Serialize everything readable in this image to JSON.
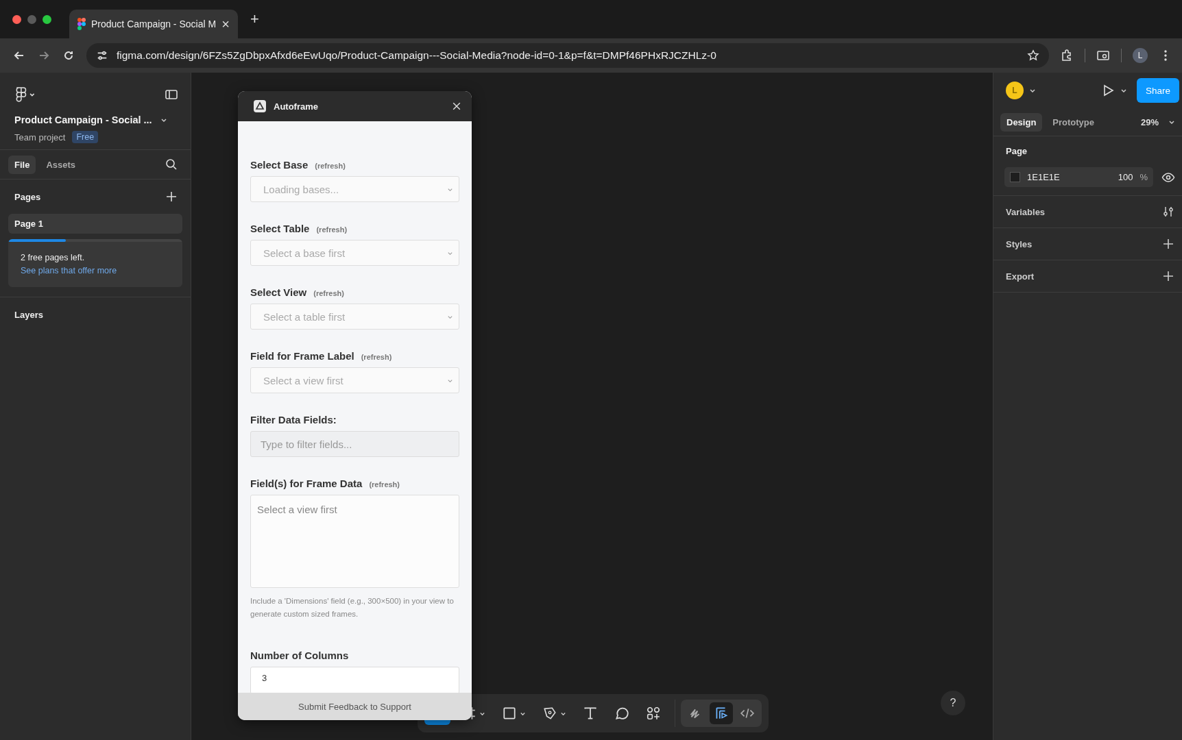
{
  "browser": {
    "tab_title": "Product Campaign - Social M",
    "tab_close": "×",
    "new_tab": "+",
    "url": "figma.com/design/6FZs5ZgDbpxAfxd6eEwUqo/Product-Campaign---Social-Media?node-id=0-1&p=f&t=DMPf46PHxRJCZHLz-0",
    "profile": "L"
  },
  "sidebar": {
    "file_title": "Product Campaign - Social ...",
    "project": "Team project",
    "plan_badge": "Free",
    "tabs": [
      {
        "label": "File",
        "selected": true
      },
      {
        "label": "Assets",
        "selected": false
      }
    ],
    "pages_heading": "Pages",
    "pages": [
      {
        "label": "Page 1",
        "selected": true
      }
    ],
    "notice": {
      "text": "2 free pages left.",
      "link": "See plans that offer more",
      "level": 0.33
    },
    "layers_heading": "Layers"
  },
  "plugin": {
    "title": "Autoframe",
    "fields": [
      {
        "kind": "select",
        "label": "Select Base",
        "hint": "(refresh)",
        "placeholder": "Loading bases..."
      },
      {
        "kind": "select",
        "label": "Select Table",
        "hint": "(refresh)",
        "placeholder": "Select a base first"
      },
      {
        "kind": "select",
        "label": "Select View",
        "hint": "(refresh)",
        "placeholder": "Select a table first"
      },
      {
        "kind": "select",
        "label": "Field for Frame Label",
        "hint": "(refresh)",
        "placeholder": "Select a view first"
      },
      {
        "kind": "input",
        "label": "Filter Data Fields:",
        "placeholder": "Type to filter fields..."
      },
      {
        "kind": "textarea",
        "label": "Field(s) for Frame Data",
        "hint": "(refresh)",
        "placeholder": "Select a view first",
        "note": "Include a 'Dimensions' field (e.g., 300×500) in your view to generate custom sized frames."
      },
      {
        "kind": "number",
        "label": "Number of Columns",
        "value": "3"
      }
    ],
    "footer": "Submit Feedback to Support"
  },
  "toolbar": {
    "tools": [
      {
        "kind": "move",
        "selected": true
      },
      {
        "kind": "frame",
        "selected": false
      },
      {
        "kind": "rectangle",
        "selected": false
      },
      {
        "kind": "pen",
        "selected": false
      },
      {
        "kind": "text",
        "selected": false
      },
      {
        "kind": "comment",
        "selected": false
      },
      {
        "kind": "actions",
        "selected": false
      }
    ],
    "modes": [
      {
        "kind": "draw",
        "selected": false
      },
      {
        "kind": "design",
        "selected": true
      },
      {
        "kind": "dev",
        "selected": false
      }
    ]
  },
  "right_panel": {
    "avatar": "L",
    "share": "Share",
    "tabs": [
      {
        "label": "Design",
        "selected": true
      },
      {
        "label": "Prototype",
        "selected": false
      }
    ],
    "zoom": "29%",
    "page_heading": "Page",
    "page_color": {
      "hex": "1E1E1E",
      "opacity": "100",
      "unit": "%",
      "color": "#1e1e1e"
    },
    "sections": [
      {
        "label": "Variables",
        "kind": "variables"
      },
      {
        "label": "Styles",
        "kind": "add"
      },
      {
        "label": "Export",
        "kind": "add"
      }
    ]
  },
  "help": "?"
}
